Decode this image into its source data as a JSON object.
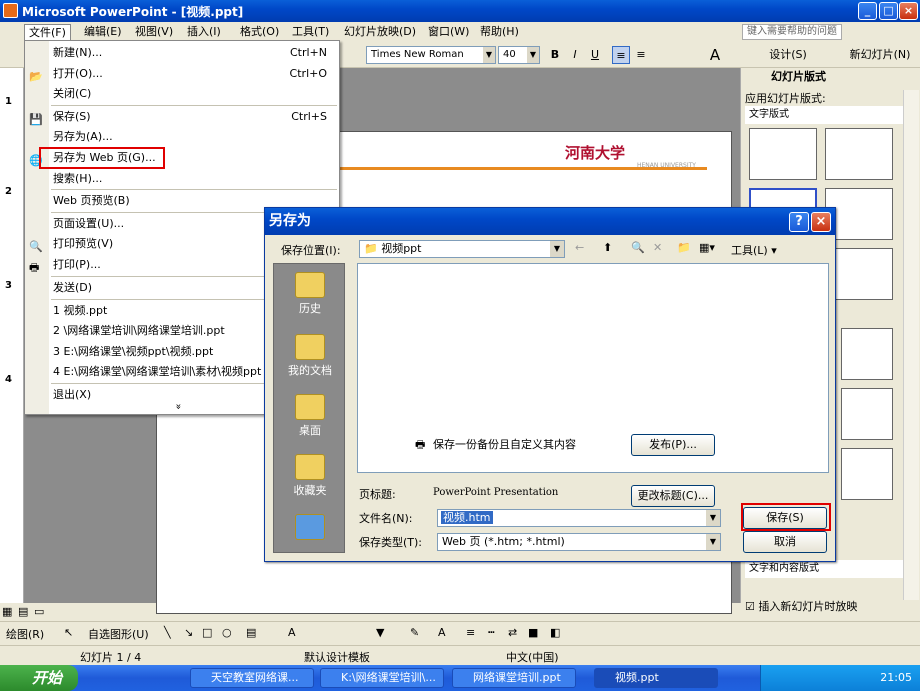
{
  "window": {
    "title": "Microsoft PowerPoint - [视频.ppt]"
  },
  "menubar": {
    "items": [
      "文件(F)",
      "编辑(E)",
      "视图(V)",
      "插入(I)",
      "格式(O)",
      "工具(T)",
      "幻灯片放映(D)",
      "窗口(W)",
      "帮助(H)"
    ],
    "help_placeholder": "键入需要帮助的问题"
  },
  "toolbar": {
    "font": "Times New Roman",
    "size": "40",
    "bold": "B",
    "italic": "I",
    "underline": "U",
    "design": "设计(S)",
    "new_slide": "新幻灯片(N)"
  },
  "slide_numbers": [
    "1",
    "2",
    "3",
    "4"
  ],
  "slide": {
    "university": "河南大学",
    "university_en": "HENAN UNIVERSITY"
  },
  "taskpane": {
    "title": "幻灯片版式",
    "apply_label": "应用幻灯片版式:",
    "group_text": "文字版式",
    "group_text_content": "文字和内容版式",
    "show_on_insert": "插入新幻灯片时放映"
  },
  "filemenu": {
    "items": [
      {
        "label": "新建(N)...",
        "shortcut": "Ctrl+N"
      },
      {
        "label": "打开(O)...",
        "shortcut": "Ctrl+O"
      },
      {
        "label": "关闭(C)",
        "shortcut": ""
      },
      {
        "label": "保存(S)",
        "shortcut": "Ctrl+S"
      },
      {
        "label": "另存为(A)...",
        "shortcut": ""
      },
      {
        "label": "另存为 Web 页(G)...",
        "shortcut": ""
      },
      {
        "label": "搜索(H)...",
        "shortcut": ""
      },
      {
        "label": "Web 页预览(B)",
        "shortcut": ""
      },
      {
        "label": "页面设置(U)...",
        "shortcut": ""
      },
      {
        "label": "打印预览(V)",
        "shortcut": ""
      },
      {
        "label": "打印(P)...",
        "shortcut": ""
      },
      {
        "label": "发送(D)",
        "shortcut": ""
      },
      {
        "label": "1 视频.ppt",
        "shortcut": ""
      },
      {
        "label": "2 \\网络课堂培训\\网络课堂培训.ppt",
        "shortcut": ""
      },
      {
        "label": "3 E:\\网络课堂\\视频ppt\\视频.ppt",
        "shortcut": ""
      },
      {
        "label": "4 E:\\网络课堂\\网络课堂培训\\素材\\视频ppt",
        "shortcut": ""
      },
      {
        "label": "退出(X)",
        "shortcut": ""
      }
    ],
    "more": "»"
  },
  "dialog": {
    "title": "另存为",
    "help": "?",
    "close": "×",
    "save_in_label": "保存位置(I):",
    "save_in_value": "视频ppt",
    "tools_label": "工具(L)",
    "places": [
      "历史",
      "我的文档",
      "桌面",
      "收藏夹"
    ],
    "backup_text": "保存一份备份且自定义其内容",
    "publish_button": "发布(P)...",
    "page_title_label": "页标题:",
    "page_title_value": "PowerPoint Presentation",
    "change_title_button": "更改标题(C)...",
    "filename_label": "文件名(N):",
    "filename_value": "视频.htm",
    "filetype_label": "保存类型(T):",
    "filetype_value": "Web 页 (*.htm; *.html)",
    "save_button": "保存(S)",
    "cancel_button": "取消"
  },
  "drawbar": {
    "draw": "绘图(R)",
    "autoshapes": "自选图形(U)"
  },
  "status": {
    "slide": "幻灯片 1 / 4",
    "template": "默认设计模板",
    "language": "中文(中国)"
  },
  "taskbar": {
    "start": "开始",
    "tasks": [
      "天空教室网络课...",
      "K:\\网络课堂培训\\...",
      "网络课堂培训.ppt",
      "视频.ppt"
    ],
    "clock": "21:05"
  }
}
